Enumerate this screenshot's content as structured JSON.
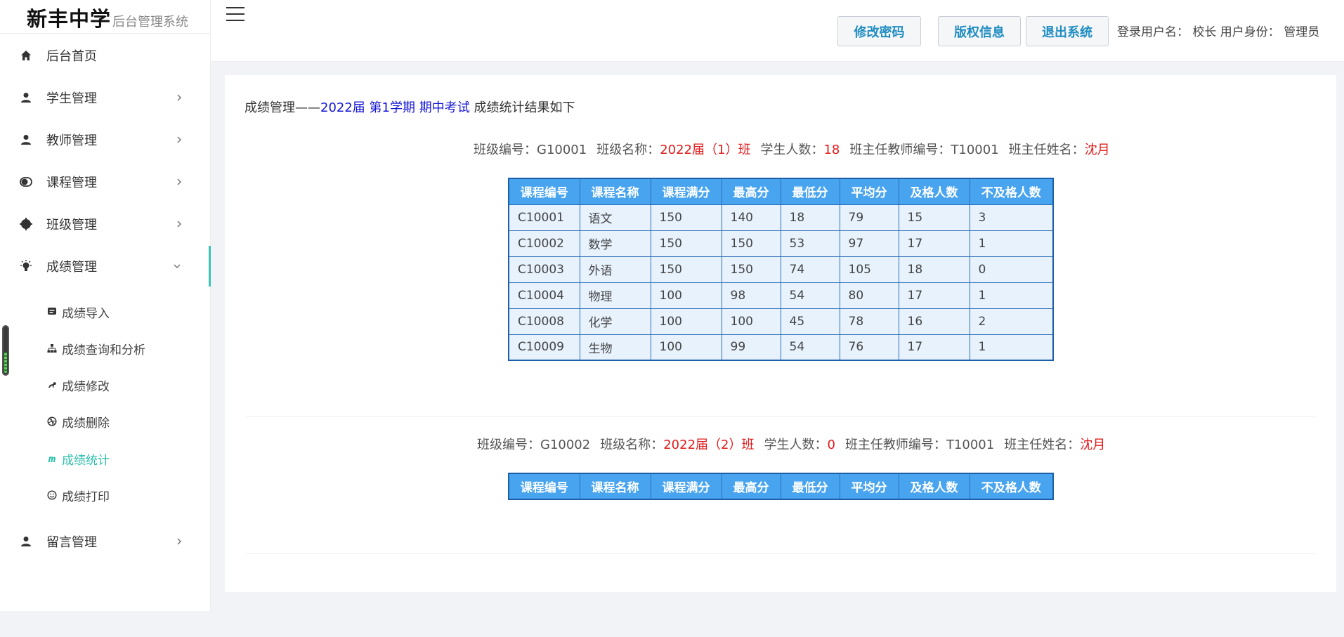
{
  "brand": {
    "school": "新丰中学",
    "system": "后台管理系统"
  },
  "sidebar": {
    "items": [
      {
        "label": "后台首页",
        "icon": "home-icon"
      },
      {
        "label": "学生管理",
        "icon": "user-icon"
      },
      {
        "label": "教师管理",
        "icon": "user-icon"
      },
      {
        "label": "课程管理",
        "icon": "toggle-icon"
      },
      {
        "label": "班级管理",
        "icon": "gear-icon"
      },
      {
        "label": "成绩管理",
        "icon": "bulb-icon"
      },
      {
        "label": "留言管理",
        "icon": "user-icon"
      }
    ],
    "sub_items": [
      {
        "label": "成绩导入",
        "icon": "chat-icon"
      },
      {
        "label": "成绩查询和分析",
        "icon": "sitemap-icon"
      },
      {
        "label": "成绩修改",
        "icon": "horse-icon"
      },
      {
        "label": "成绩删除",
        "icon": "dribbble-icon"
      },
      {
        "label": "成绩统计",
        "icon": "m-icon"
      },
      {
        "label": "成绩打印",
        "icon": "smile-icon"
      }
    ],
    "accent_color": "#3cc4b4"
  },
  "header": {
    "buttons": {
      "change_password": "修改密码",
      "copyright": "版权信息",
      "logout": "退出系统"
    },
    "login_info": "登录用户名：  校长  用户身份：  管理员"
  },
  "main": {
    "heading_prefix": "成绩管理——",
    "heading_year": "2022届",
    "heading_term": "第1学期",
    "heading_exam": "期中考试",
    "heading_suffix": "成绩统计结果如下",
    "columns": [
      "课程编号",
      "课程名称",
      "课程满分",
      "最高分",
      "最低分",
      "平均分",
      "及格人数",
      "不及格人数"
    ],
    "classes": [
      {
        "id_label": "班级编号：",
        "id": "G10001",
        "name_label": "班级名称：",
        "name": "2022届（1）班",
        "count_label": "学生人数：",
        "count": "18",
        "teacher_id_label": "班主任教师编号：",
        "teacher_id": "T10001",
        "teacher_name_label": "班主任姓名：",
        "teacher_name": "沈月",
        "rows": [
          [
            "C10001",
            "语文",
            "150",
            "140",
            "18",
            "79",
            "15",
            "3"
          ],
          [
            "C10002",
            "数学",
            "150",
            "150",
            "53",
            "97",
            "17",
            "1"
          ],
          [
            "C10003",
            "外语",
            "150",
            "150",
            "74",
            "105",
            "18",
            "0"
          ],
          [
            "C10004",
            "物理",
            "100",
            "98",
            "54",
            "80",
            "17",
            "1"
          ],
          [
            "C10008",
            "化学",
            "100",
            "100",
            "45",
            "78",
            "16",
            "2"
          ],
          [
            "C10009",
            "生物",
            "100",
            "99",
            "54",
            "76",
            "17",
            "1"
          ]
        ]
      },
      {
        "id_label": "班级编号：",
        "id": "G10002",
        "name_label": "班级名称：",
        "name": "2022届（2）班",
        "count_label": "学生人数：",
        "count": "0",
        "teacher_id_label": "班主任教师编号：",
        "teacher_id": "T10001",
        "teacher_name_label": "班主任姓名：",
        "teacher_name": "沈月",
        "rows": []
      }
    ]
  },
  "colors": {
    "header_button_text": "#1f8dc2",
    "highlight_red": "#e21b1b",
    "heading_blue": "#1414d8",
    "table_header_bg": "#49a4f0",
    "table_cell_bg": "#e7f2fd",
    "current_sub_item": "#2bbfac"
  }
}
